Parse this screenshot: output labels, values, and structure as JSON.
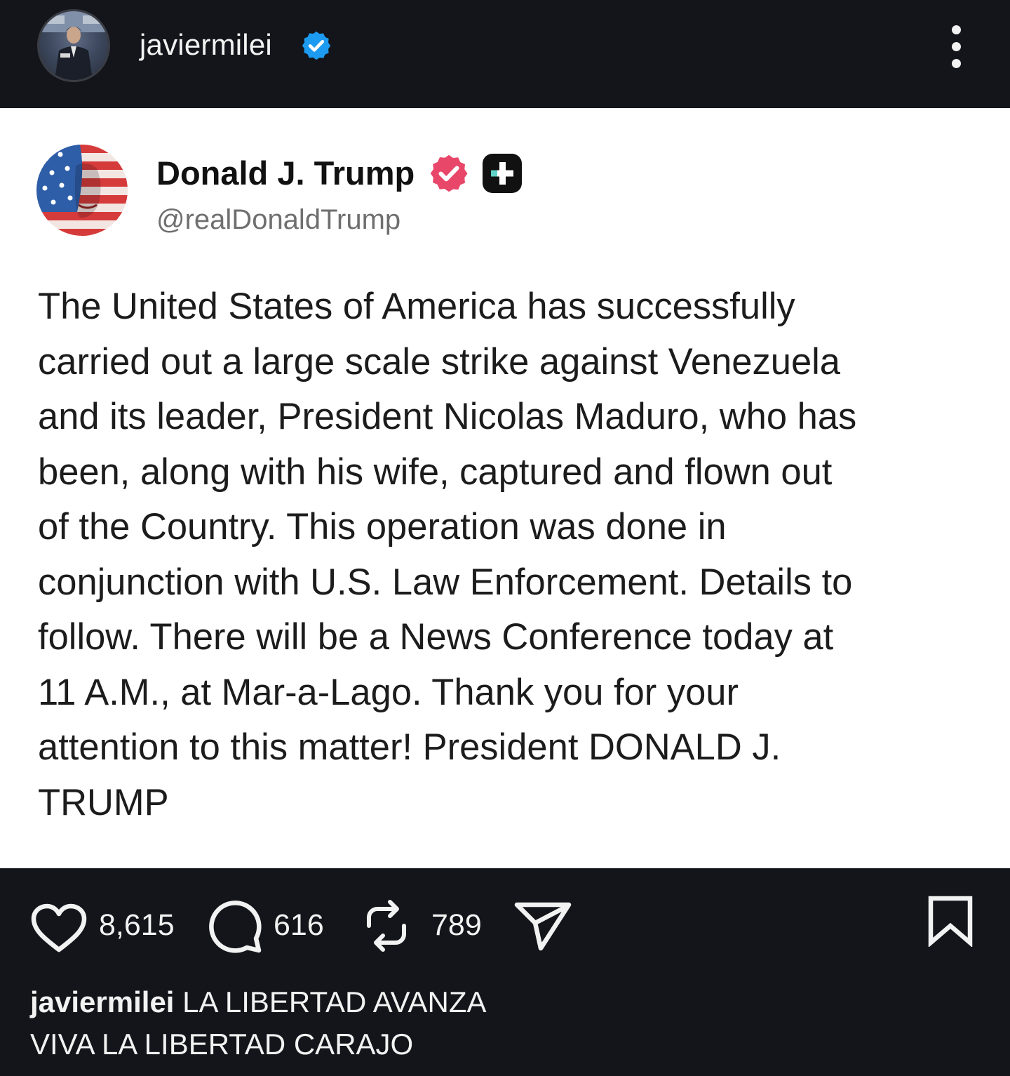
{
  "header": {
    "username": "javiermilei",
    "avatar_icon": "profile-photo",
    "verified_icon": "verified-badge-icon",
    "verified_color": "#1d9bf0",
    "more_icon": "more-vertical-icon"
  },
  "embedded_post": {
    "author_name": "Donald J. Trump",
    "author_handle": "@realDonaldTrump",
    "verified_color": "#e8476a",
    "plus_icon": "truth-social-plus-icon",
    "text_lines": [
      "The United States of America has successfully",
      "carried out a large scale strike against Venezuela",
      "and its leader, President Nicolas Maduro, who has",
      "been, along with his wife, captured and flown out",
      "of the Country. This operation was done in",
      "conjunction with U.S. Law Enforcement. Details to",
      "follow. There will be a News Conference today at",
      "11 A.M., at Mar-a-Lago. Thank you for your",
      "attention to this matter! President DONALD J.",
      "TRUMP"
    ]
  },
  "actions": {
    "likes": "8,615",
    "comments": "616",
    "reposts": "789",
    "icons": [
      "heart-icon",
      "comment-icon",
      "repost-icon",
      "share-icon",
      "bookmark-icon"
    ]
  },
  "caption": {
    "username": "javiermilei",
    "line1": "LA LIBERTAD AVANZA",
    "line2": "VIVA LA LIBERTAD CARAJO"
  }
}
